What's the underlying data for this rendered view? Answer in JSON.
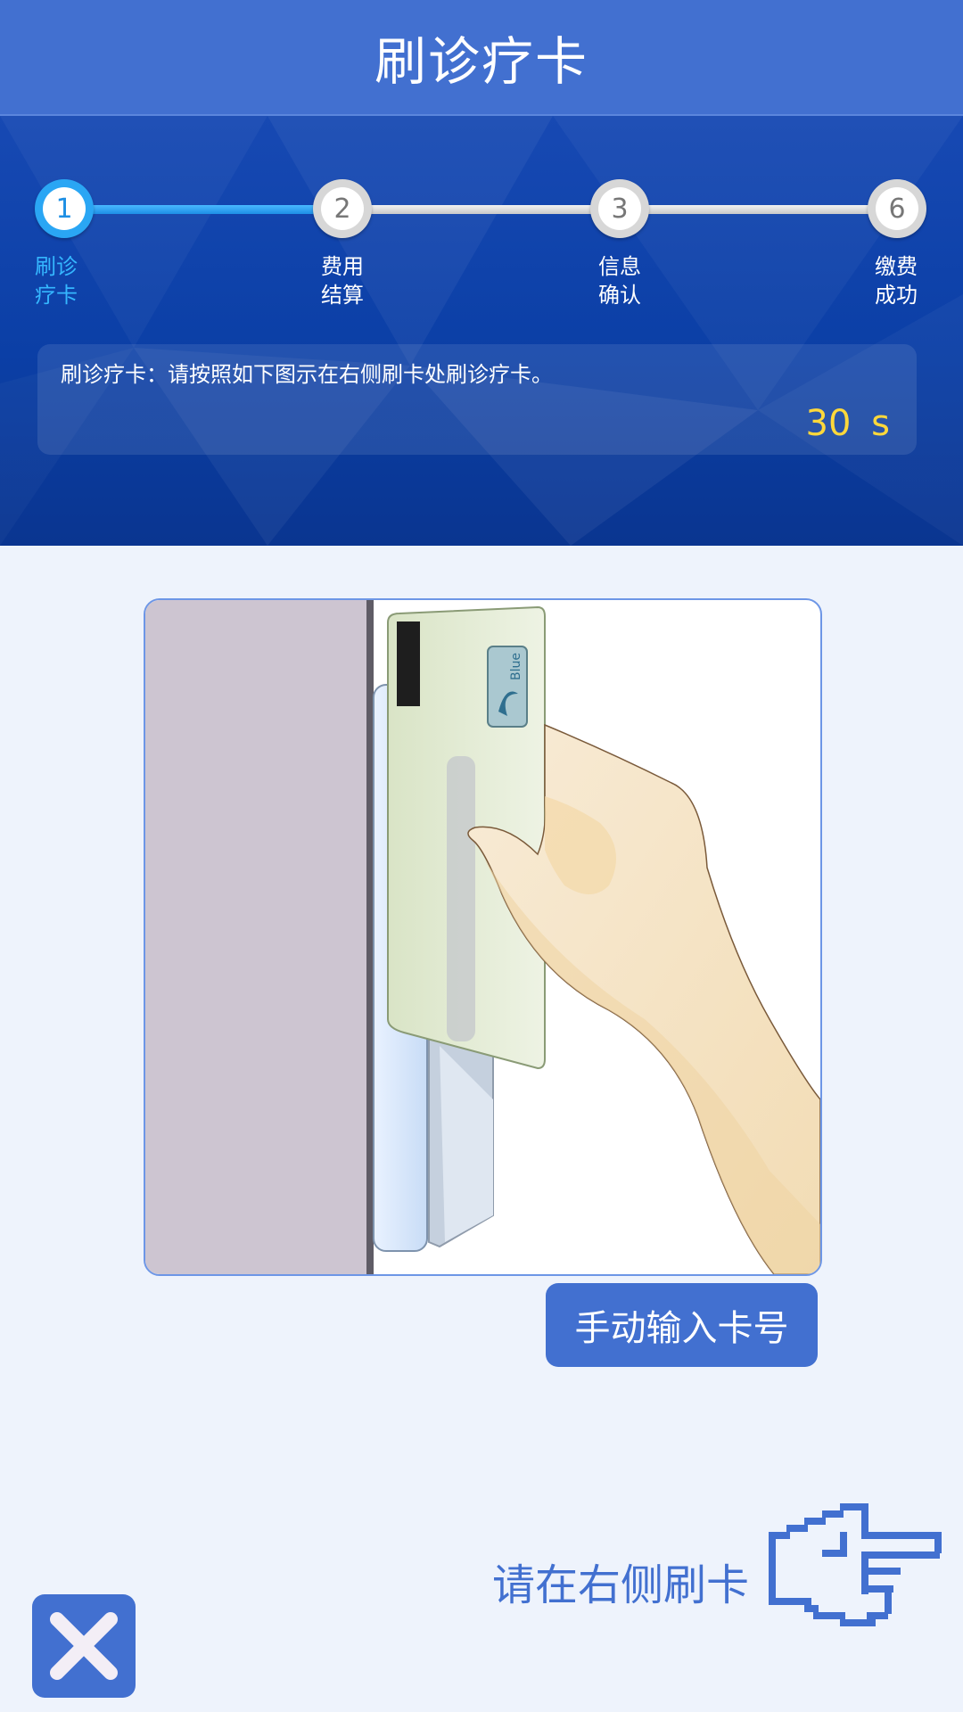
{
  "header": {
    "title": "刷诊疗卡"
  },
  "steps": [
    {
      "number": "1",
      "label_line1": "刷诊",
      "label_line2": "疗卡",
      "active": true
    },
    {
      "number": "2",
      "label_line1": "费用",
      "label_line2": "结算",
      "active": false
    },
    {
      "number": "3",
      "label_line1": "信息",
      "label_line2": "确认",
      "active": false
    },
    {
      "number": "6",
      "label_line1": "缴费",
      "label_line2": "成功",
      "active": false
    }
  ],
  "info": {
    "instruction": "刷诊疗卡：请按照如下图示在右侧刷卡处刷诊疗卡。",
    "countdown": "30 s"
  },
  "illustration": {
    "card_brand": "Blue"
  },
  "buttons": {
    "manual_input": "手动输入卡号"
  },
  "prompt": {
    "text": "请在右侧刷卡"
  },
  "colors": {
    "brand_blue": "#4270d0",
    "active_step": "#2aa6f4",
    "countdown": "#ffd83b",
    "page_bg": "#eef3fc"
  },
  "icons": [
    "close-icon",
    "pointing-hand-icon"
  ]
}
